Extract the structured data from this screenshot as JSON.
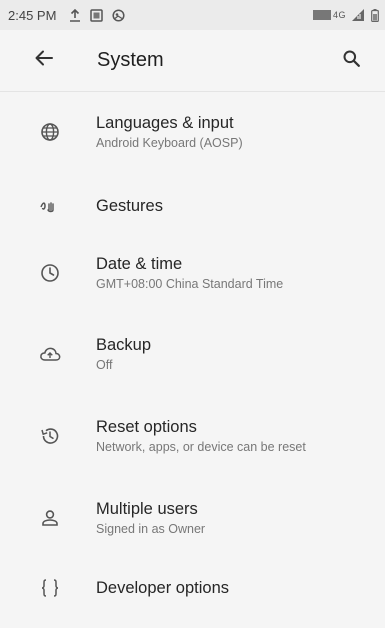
{
  "status_bar": {
    "time": "2:45 PM",
    "notification_icons": [
      "upload-icon",
      "screenshot-icon",
      "gallery-icon"
    ],
    "network_label": "4G"
  },
  "toolbar": {
    "title": "System",
    "back_icon": "arrow-back-icon",
    "search_icon": "search-icon"
  },
  "items": [
    {
      "id": "languages",
      "icon": "globe-icon",
      "title": "Languages & input",
      "subtitle": "Android Keyboard (AOSP)"
    },
    {
      "id": "gestures",
      "icon": "gestures-icon",
      "title": "Gestures",
      "subtitle": ""
    },
    {
      "id": "date-time",
      "icon": "clock-icon",
      "title": "Date & time",
      "subtitle": "GMT+08:00 China Standard Time"
    },
    {
      "id": "backup",
      "icon": "cloud-upload-icon",
      "title": "Backup",
      "subtitle": "Off"
    },
    {
      "id": "reset",
      "icon": "restore-icon",
      "title": "Reset options",
      "subtitle": "Network, apps, or device can be reset"
    },
    {
      "id": "users",
      "icon": "person-icon",
      "title": "Multiple users",
      "subtitle": "Signed in as Owner"
    },
    {
      "id": "developer",
      "icon": "braces-icon",
      "title": "Developer options",
      "subtitle": ""
    }
  ]
}
